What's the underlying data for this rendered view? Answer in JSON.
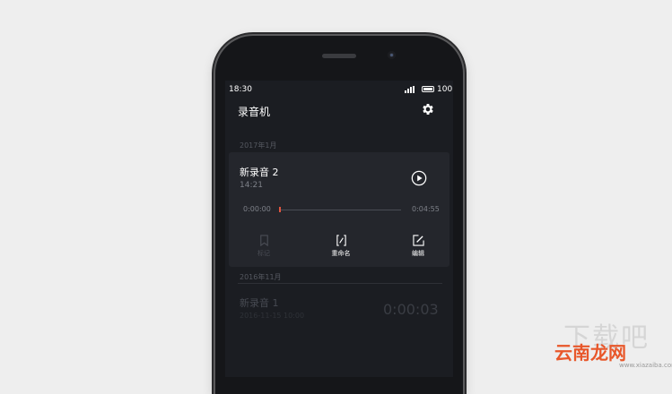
{
  "status_bar": {
    "time": "18:30",
    "battery": "100"
  },
  "header": {
    "title": "录音机",
    "settings_icon": "gear-icon"
  },
  "sections": [
    {
      "label": "2017年1月",
      "recordings": [
        {
          "name": "新录音 2",
          "time": "14:21",
          "expanded": true,
          "position": "0:00:00",
          "duration": "0:04:55",
          "progress": 0,
          "actions": [
            {
              "label": "标记",
              "icon": "bookmark-icon",
              "enabled": false
            },
            {
              "label": "重命名",
              "icon": "rename-icon",
              "enabled": true
            },
            {
              "label": "编辑",
              "icon": "edit-icon",
              "enabled": true
            }
          ]
        }
      ]
    },
    {
      "label": "2016年11月",
      "recordings": [
        {
          "name": "新录音 1",
          "meta": "2016-11-15 10:00",
          "duration": "0:00:03",
          "expanded": false
        }
      ]
    }
  ],
  "watermark": {
    "brand": "云南龙网",
    "url": "www.xiazaiba.com",
    "ghost": "下载吧"
  },
  "colors": {
    "background": "#eeeeee",
    "screen": "#1b1d22",
    "card": "#24262c",
    "progress": "#e0553f",
    "watermark": "#e8572a"
  }
}
